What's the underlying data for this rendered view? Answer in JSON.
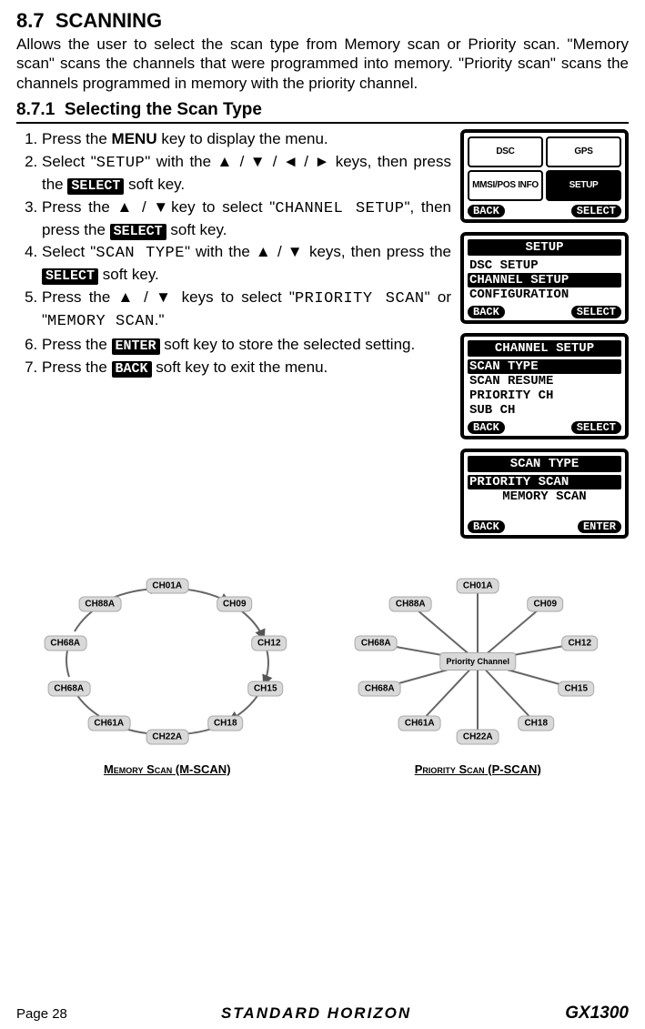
{
  "section": {
    "number": "8.7",
    "title": "SCANNING",
    "intro": "Allows the user to select the scan type from Memory scan or Priority scan. \"Memory scan\" scans the channels that were programmed into memory. \"Priority scan\" scans the channels programmed in memory with the priority channel."
  },
  "subsection": {
    "number": "8.7.1",
    "title": "Selecting the Scan Type"
  },
  "steps": {
    "s1_pre": "Press the ",
    "s1_key": "MENU",
    "s1_post": " key to display the menu.",
    "s2_pre": "Select \"",
    "s2_code": "SETUP",
    "s2_mid": "\" with the ▲ / ▼ / ◄ / ► keys, then press the ",
    "s2_btn": "SELECT",
    "s2_post": " soft key.",
    "s3_pre": "Press the ▲ / ▼key to select \"",
    "s3_code": "CHANNEL SETUP",
    "s3_mid": "\", then press the ",
    "s3_btn": "SELECT",
    "s3_post": " soft key.",
    "s4_pre": "Select \"",
    "s4_code": "SCAN TYPE",
    "s4_mid": "\" with the ▲ / ▼ keys, then press the ",
    "s4_btn": "SELECT",
    "s4_post": " soft key.",
    "s5_pre": "Press the ▲ / ▼ keys to select \"",
    "s5_code1": "PRIORITY SCAN",
    "s5_mid": "\" or \"",
    "s5_code2": "MEMORY SCAN",
    "s5_post": ".\"",
    "s6_pre": "Press the ",
    "s6_btn": "ENTER",
    "s6_post": " soft key to store the selected setting.",
    "s7_pre": "Press the ",
    "s7_btn": "BACK",
    "s7_post": " soft key to exit the menu."
  },
  "screens": {
    "menu": {
      "cells": [
        "DSC",
        "GPS",
        "MMSI/POS INFO",
        "SETUP"
      ],
      "back": "BACK",
      "select": "SELECT"
    },
    "setup": {
      "title": "SETUP",
      "items": [
        "DSC SETUP",
        "CHANNEL SETUP",
        "CONFIGURATION"
      ],
      "selected_index": 1,
      "back": "BACK",
      "select": "SELECT"
    },
    "channel_setup": {
      "title": "CHANNEL SETUP",
      "items": [
        "SCAN TYPE",
        "SCAN RESUME",
        "PRIORITY CH",
        "SUB CH"
      ],
      "selected_index": 0,
      "back": "BACK",
      "select": "SELECT"
    },
    "scan_type": {
      "title": "SCAN TYPE",
      "items": [
        "PRIORITY SCAN",
        "MEMORY SCAN"
      ],
      "selected_index": 0,
      "back": "BACK",
      "enter": "ENTER"
    }
  },
  "diagrams": {
    "channels": [
      "CH01A",
      "CH09",
      "CH12",
      "CH15",
      "CH18",
      "CH22A",
      "CH61A",
      "CH68A",
      "CH68A",
      "CH88A"
    ],
    "memory_caption_label": "Memory Scan",
    "memory_caption_code": "(M-SCAN)",
    "priority_center": "Priority Channel",
    "priority_caption_label": "Priority Scan",
    "priority_caption_code": "(P-SCAN)"
  },
  "footer": {
    "page": "Page 28",
    "brand": "STANDARD HORIZON",
    "model": "GX1300"
  }
}
